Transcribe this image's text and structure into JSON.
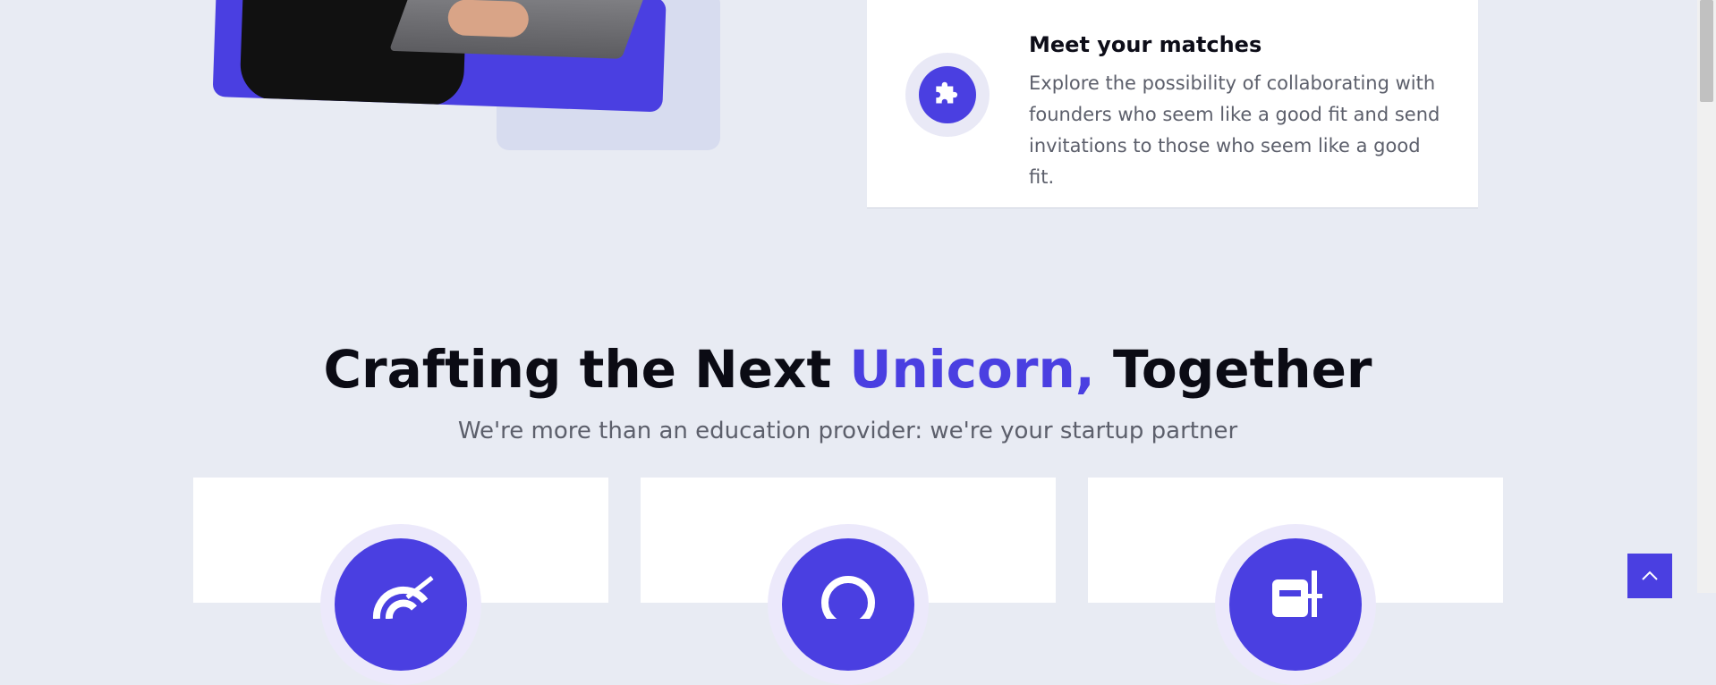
{
  "match_card": {
    "title": "Meet your matches",
    "description": "Explore the possibility of collaborating with founders who seem like a good fit and send invitations to those who seem like a good fit.",
    "icon": "puzzle-icon"
  },
  "section": {
    "heading_before": "Crafting the Next ",
    "heading_accent": "Unicorn,",
    "heading_after": " Together",
    "subheading": "We're more than an education provider: we're your startup partner"
  },
  "service_cards": [
    {
      "icon": "target-icon"
    },
    {
      "icon": "search-icon"
    },
    {
      "icon": "clipboard-icon"
    }
  ],
  "scroll_top": {
    "icon": "chevron-up-icon"
  },
  "colors": {
    "accent": "#4a3fe1",
    "background": "#e8ebf3",
    "card": "#ffffff",
    "text": "#0b0b14",
    "muted_text": "#5c5f6b"
  }
}
